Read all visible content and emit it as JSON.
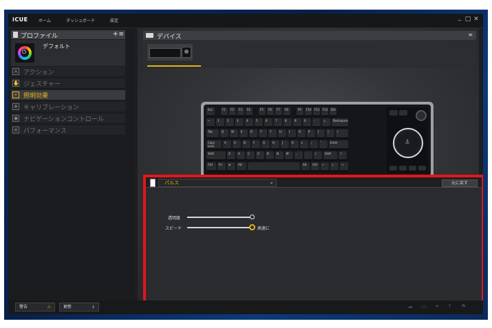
{
  "app": {
    "logo": "iCUE"
  },
  "nav": {
    "home": "ホーム",
    "dashboard": "ダッシュボード",
    "settings": "設定"
  },
  "window_controls": {
    "minimize": "_",
    "maximize": "□",
    "close": "✕"
  },
  "profile_panel": {
    "title": "プロファイル",
    "add": "+",
    "menu": "≡",
    "profile_name": "デフォルト"
  },
  "menu_items": [
    {
      "icon": "A",
      "label": "アクション"
    },
    {
      "icon": "✋",
      "label": "ジェスチャー"
    },
    {
      "icon": "⚡",
      "label": "照明効果",
      "selected": true
    },
    {
      "icon": "⊕",
      "label": "キャリブレーション"
    },
    {
      "icon": "◉",
      "label": "ナビゲーションコントロール"
    },
    {
      "icon": "≡",
      "label": "パフォーマンス"
    }
  ],
  "devices": {
    "title": "デバイス",
    "menu": "≡"
  },
  "keyboard_rows": [
    [
      [
        "Esc",
        12
      ],
      [
        "",
        5
      ],
      [
        "F1",
        10
      ],
      [
        "F2",
        10
      ],
      [
        "F3",
        10
      ],
      [
        "F4",
        10
      ],
      [
        "",
        5
      ],
      [
        "F5",
        10
      ],
      [
        "F6",
        10
      ],
      [
        "F7",
        10
      ],
      [
        "F8",
        10
      ],
      [
        "",
        5
      ],
      [
        "F9",
        10
      ],
      [
        "F10",
        10
      ],
      [
        "F11",
        10
      ],
      [
        "F12",
        10
      ],
      [
        "Del",
        10
      ]
    ],
    [
      [
        "~",
        12
      ],
      [
        "1",
        12
      ],
      [
        "2",
        12
      ],
      [
        "3",
        12
      ],
      [
        "4",
        12
      ],
      [
        "5",
        12
      ],
      [
        "6",
        12
      ],
      [
        "7",
        12
      ],
      [
        "8",
        12
      ],
      [
        "9",
        12
      ],
      [
        "0",
        12
      ],
      [
        "-",
        12
      ],
      [
        "=",
        12
      ],
      [
        "Backspace",
        24
      ]
    ],
    [
      [
        "Tab",
        18
      ],
      [
        "Q",
        12
      ],
      [
        "W",
        12
      ],
      [
        "E",
        12
      ],
      [
        "R",
        12
      ],
      [
        "T",
        12
      ],
      [
        "Y",
        12
      ],
      [
        "U",
        12
      ],
      [
        "I",
        12
      ],
      [
        "O",
        12
      ],
      [
        "P",
        12
      ],
      [
        "[",
        12
      ],
      [
        "]",
        12
      ],
      [
        "\\",
        18
      ]
    ],
    [
      [
        "Caps Lock",
        22
      ],
      [
        "A",
        12
      ],
      [
        "S",
        12
      ],
      [
        "D",
        12
      ],
      [
        "F",
        12
      ],
      [
        "G",
        12
      ],
      [
        "H",
        12
      ],
      [
        "J",
        12
      ],
      [
        "K",
        12
      ],
      [
        "L",
        12
      ],
      [
        ";",
        12
      ],
      [
        "'",
        12
      ],
      [
        "Enter",
        28
      ]
    ],
    [
      [
        "Shift",
        28
      ],
      [
        "Z",
        12
      ],
      [
        "X",
        12
      ],
      [
        "C",
        12
      ],
      [
        "V",
        12
      ],
      [
        "B",
        12
      ],
      [
        "N",
        12
      ],
      [
        "M",
        12
      ],
      [
        ",",
        12
      ],
      [
        ".",
        12
      ],
      [
        "/",
        12
      ],
      [
        "Shift",
        20
      ],
      [
        "↑",
        12
      ]
    ],
    [
      [
        "Ctrl",
        14
      ],
      [
        "Fn",
        12
      ],
      [
        "⊞",
        12
      ],
      [
        "Alt",
        14
      ],
      [
        "",
        76
      ],
      [
        "Alt",
        12
      ],
      [
        "Ctrl",
        12
      ],
      [
        "←",
        12
      ],
      [
        "↓",
        12
      ],
      [
        "→",
        12
      ]
    ]
  ],
  "lighting": {
    "effect": "パルス",
    "reset_button": "元に戻す",
    "transparency_label": "透明度",
    "speed_label": "スピード",
    "speed_value": "高速に",
    "transparency_level": 1.0,
    "speed_level": 1.0
  },
  "bottom": {
    "warning_label": "警告",
    "warning_icon": "⚠",
    "update_label": "更新",
    "update_icon": "↓"
  },
  "social_icons": [
    "community-icon",
    "chat-icon",
    "twitter-icon",
    "facebook-icon",
    "corsair-icon"
  ]
}
